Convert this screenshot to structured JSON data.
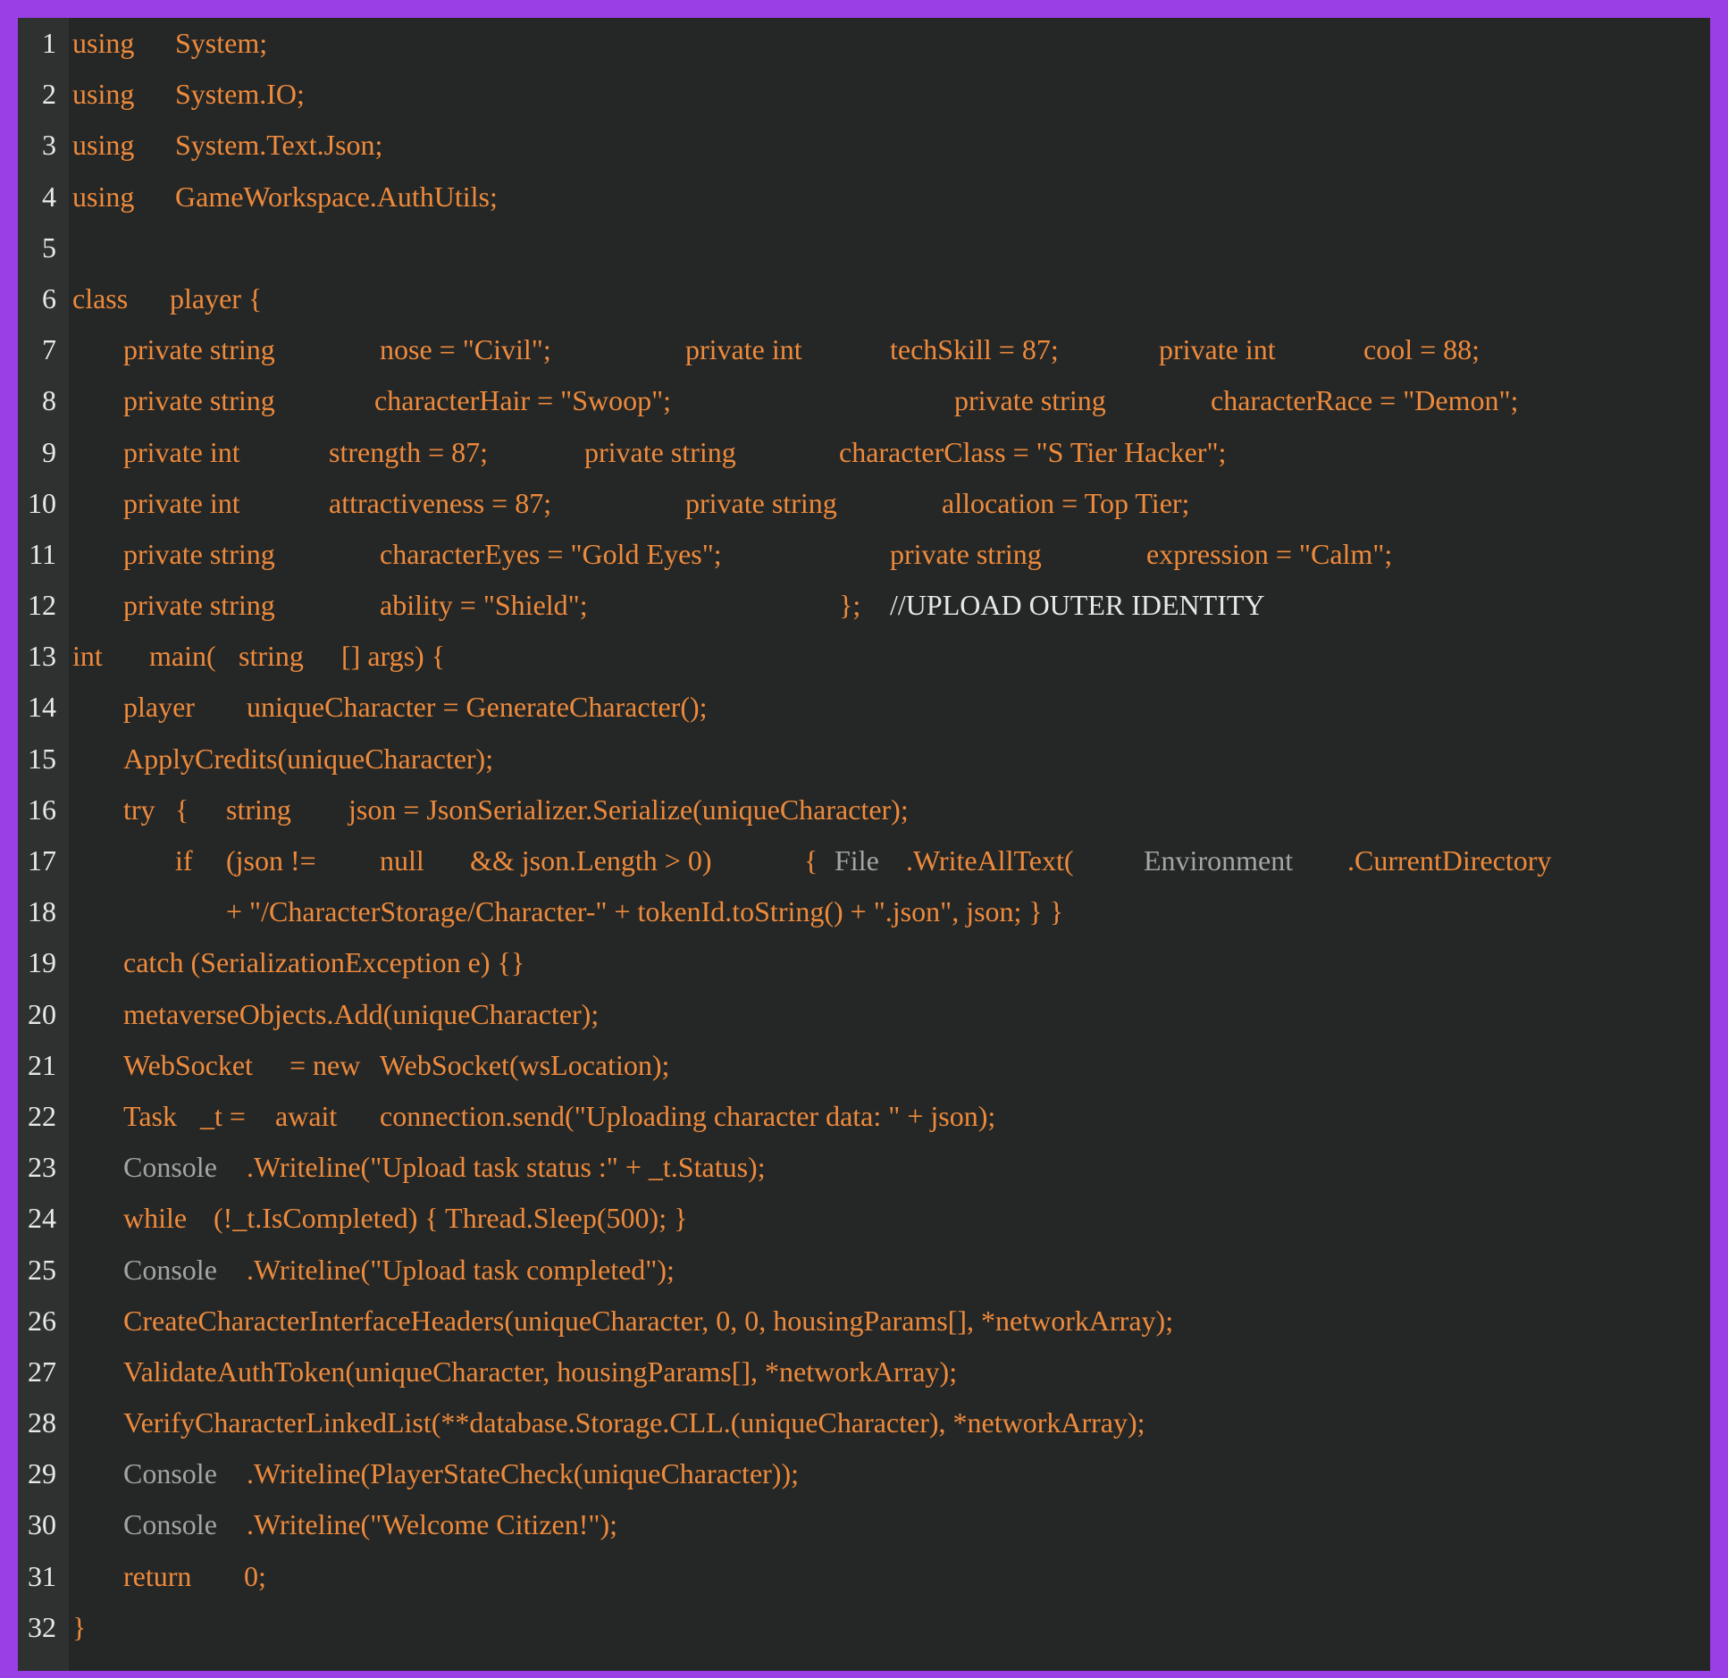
{
  "colors": {
    "frame": "#9a3fe6",
    "editor_background": "#252726",
    "gutter_background": "#2f3130",
    "code_orange": "#ee8a3c",
    "code_gray": "#a3a4a4",
    "line_number": "#e9e9e9"
  },
  "lines": [
    {
      "number": "1",
      "segments": [
        {
          "text": "using",
          "color": "orange",
          "indent": 0
        },
        {
          "text": "System;",
          "color": "orange",
          "indent": 115
        }
      ]
    },
    {
      "number": "2",
      "segments": [
        {
          "text": "using",
          "color": "orange",
          "indent": 0
        },
        {
          "text": "System.IO;",
          "color": "orange",
          "indent": 115
        }
      ]
    },
    {
      "number": "3",
      "segments": [
        {
          "text": "using",
          "color": "orange",
          "indent": 0
        },
        {
          "text": "System.Text.Json;",
          "color": "orange",
          "indent": 115
        }
      ]
    },
    {
      "number": "4",
      "segments": [
        {
          "text": "using",
          "color": "orange",
          "indent": 0
        },
        {
          "text": "GameWorkspace.AuthUtils;",
          "color": "orange",
          "indent": 115
        }
      ]
    },
    {
      "number": "5",
      "segments": []
    },
    {
      "number": "6",
      "segments": [
        {
          "text": "class",
          "color": "orange",
          "indent": 0
        },
        {
          "text": "player {",
          "color": "orange",
          "indent": 109
        }
      ]
    },
    {
      "number": "7",
      "segments": [
        {
          "text": "private string",
          "color": "orange",
          "indent": 57
        },
        {
          "text": "nose = \"Civil\";",
          "color": "orange",
          "indent": 344
        },
        {
          "text": "private int",
          "color": "orange",
          "indent": 686
        },
        {
          "text": "techSkill = 87;",
          "color": "orange",
          "indent": 915
        },
        {
          "text": "private int",
          "color": "orange",
          "indent": 1216
        },
        {
          "text": "cool = 88;",
          "color": "orange",
          "indent": 1445
        }
      ]
    },
    {
      "number": "8",
      "segments": [
        {
          "text": "private string",
          "color": "orange",
          "indent": 57
        },
        {
          "text": "characterHair = \"Swoop\";",
          "color": "orange",
          "indent": 338
        },
        {
          "text": "private string",
          "color": "orange",
          "indent": 987
        },
        {
          "text": "characterRace = \"Demon\";",
          "color": "orange",
          "indent": 1274
        }
      ]
    },
    {
      "number": "9",
      "segments": [
        {
          "text": "private int",
          "color": "orange",
          "indent": 57
        },
        {
          "text": "strength = 87;",
          "color": "orange",
          "indent": 287
        },
        {
          "text": "private string",
          "color": "orange",
          "indent": 573
        },
        {
          "text": "characterClass = \"S Tier Hacker\";",
          "color": "orange",
          "indent": 858
        }
      ]
    },
    {
      "number": "10",
      "segments": [
        {
          "text": "private int",
          "color": "orange",
          "indent": 57
        },
        {
          "text": "attractiveness = 87;",
          "color": "orange",
          "indent": 287
        },
        {
          "text": "private string",
          "color": "orange",
          "indent": 686
        },
        {
          "text": "allocation = Top Tier;",
          "color": "orange",
          "indent": 973
        }
      ]
    },
    {
      "number": "11",
      "segments": [
        {
          "text": "private string",
          "color": "orange",
          "indent": 57
        },
        {
          "text": "characterEyes = \"Gold Eyes\";",
          "color": "orange",
          "indent": 344
        },
        {
          "text": "private string",
          "color": "orange",
          "indent": 915
        },
        {
          "text": "expression = \"Calm\";",
          "color": "orange",
          "indent": 1202
        }
      ]
    },
    {
      "number": "12",
      "segments": [
        {
          "text": "private string",
          "color": "orange",
          "indent": 57
        },
        {
          "text": "ability = \"Shield\";",
          "color": "orange",
          "indent": 344
        },
        {
          "text": "};",
          "color": "orange",
          "indent": 858
        },
        {
          "text": "//UPLOAD OUTER IDENTITY",
          "color": "white",
          "indent": 915
        }
      ]
    },
    {
      "number": "13",
      "segments": [
        {
          "text": "int",
          "color": "orange",
          "indent": 0
        },
        {
          "text": "main(",
          "color": "orange",
          "indent": 86
        },
        {
          "text": "string",
          "color": "orange",
          "indent": 186
        },
        {
          "text": "[] args) {",
          "color": "orange",
          "indent": 301
        }
      ]
    },
    {
      "number": "14",
      "segments": [
        {
          "text": "player",
          "color": "orange",
          "indent": 57
        },
        {
          "text": "uniqueCharacter = GenerateCharacter();",
          "color": "orange",
          "indent": 195
        }
      ]
    },
    {
      "number": "15",
      "segments": [
        {
          "text": "ApplyCredits(uniqueCharacter);",
          "color": "orange",
          "indent": 57
        }
      ]
    },
    {
      "number": "16",
      "segments": [
        {
          "text": "try",
          "color": "orange",
          "indent": 57
        },
        {
          "text": "{",
          "color": "orange",
          "indent": 115
        },
        {
          "text": "string",
          "color": "orange",
          "indent": 172
        },
        {
          "text": "json = JsonSerializer.Serialize(uniqueCharacter);",
          "color": "orange",
          "indent": 309
        }
      ]
    },
    {
      "number": "17",
      "segments": [
        {
          "text": "if",
          "color": "orange",
          "indent": 115
        },
        {
          "text": "(json !=",
          "color": "orange",
          "indent": 172
        },
        {
          "text": "null",
          "color": "orange",
          "indent": 344
        },
        {
          "text": "&& json.Length > 0)",
          "color": "orange",
          "indent": 445
        },
        {
          "text": "{",
          "color": "orange",
          "indent": 819
        },
        {
          "text": "File",
          "color": "gray",
          "indent": 853
        },
        {
          "text": ".WriteAllText(",
          "color": "orange",
          "indent": 933
        },
        {
          "text": "Environment",
          "color": "gray",
          "indent": 1199
        },
        {
          "text": ".CurrentDirectory",
          "color": "orange",
          "indent": 1427
        }
      ]
    },
    {
      "number": "18",
      "segments": [
        {
          "text": "+ \"/CharacterStorage/Character-\" + tokenId.toString() + \".json\", json; } }",
          "color": "orange",
          "indent": 172
        }
      ]
    },
    {
      "number": "19",
      "segments": [
        {
          "text": "catch (SerializationException e) {}",
          "color": "orange",
          "indent": 57
        }
      ]
    },
    {
      "number": "20",
      "segments": [
        {
          "text": "metaverseObjects.Add(uniqueCharacter);",
          "color": "orange",
          "indent": 57
        }
      ]
    },
    {
      "number": "21",
      "segments": [
        {
          "text": "WebSocket",
          "color": "orange",
          "indent": 57
        },
        {
          "text": "= new",
          "color": "orange",
          "indent": 243
        },
        {
          "text": "WebSocket(wsLocation);",
          "color": "orange",
          "indent": 344
        }
      ]
    },
    {
      "number": "22",
      "segments": [
        {
          "text": "Task",
          "color": "orange",
          "indent": 57
        },
        {
          "text": "_t =",
          "color": "orange",
          "indent": 143
        },
        {
          "text": "await",
          "color": "orange",
          "indent": 227
        },
        {
          "text": "connection.send(\"Uploading character data: \" + json);",
          "color": "orange",
          "indent": 344
        }
      ]
    },
    {
      "number": "23",
      "segments": [
        {
          "text": "Console",
          "color": "gray",
          "indent": 57
        },
        {
          "text": ".Writeline(\"Upload task status :\" + _t.Status);",
          "color": "orange",
          "indent": 195
        }
      ]
    },
    {
      "number": "24",
      "segments": [
        {
          "text": "while",
          "color": "orange",
          "indent": 57
        },
        {
          "text": "(!_t.IsCompleted) { Thread.Sleep(500); }",
          "color": "orange",
          "indent": 158
        }
      ]
    },
    {
      "number": "25",
      "segments": [
        {
          "text": "Console",
          "color": "gray",
          "indent": 57
        },
        {
          "text": ".Writeline(\"Upload task completed\");",
          "color": "orange",
          "indent": 195
        }
      ]
    },
    {
      "number": "26",
      "segments": [
        {
          "text": "CreateCharacterInterfaceHeaders(uniqueCharacter, 0, 0, housingParams[], *networkArray);",
          "color": "orange",
          "indent": 57
        }
      ]
    },
    {
      "number": "27",
      "segments": [
        {
          "text": "ValidateAuthToken(uniqueCharacter, housingParams[], *networkArray);",
          "color": "orange",
          "indent": 57
        }
      ]
    },
    {
      "number": "28",
      "segments": [
        {
          "text": "VerifyCharacterLinkedList(**database.Storage.CLL.(uniqueCharacter), *networkArray);",
          "color": "orange",
          "indent": 57
        }
      ]
    },
    {
      "number": "29",
      "segments": [
        {
          "text": "Console",
          "color": "gray",
          "indent": 57
        },
        {
          "text": ".Writeline(PlayerStateCheck(uniqueCharacter));",
          "color": "orange",
          "indent": 195
        }
      ]
    },
    {
      "number": "30",
      "segments": [
        {
          "text": "Console",
          "color": "gray",
          "indent": 57
        },
        {
          "text": ".Writeline(\"Welcome Citizen!\");",
          "color": "orange",
          "indent": 195
        }
      ]
    },
    {
      "number": "31",
      "segments": [
        {
          "text": "return",
          "color": "orange",
          "indent": 57
        },
        {
          "text": "0;",
          "color": "orange",
          "indent": 192
        }
      ]
    },
    {
      "number": "32",
      "segments": [
        {
          "text": "}",
          "color": "orange",
          "indent": 0
        }
      ]
    }
  ]
}
